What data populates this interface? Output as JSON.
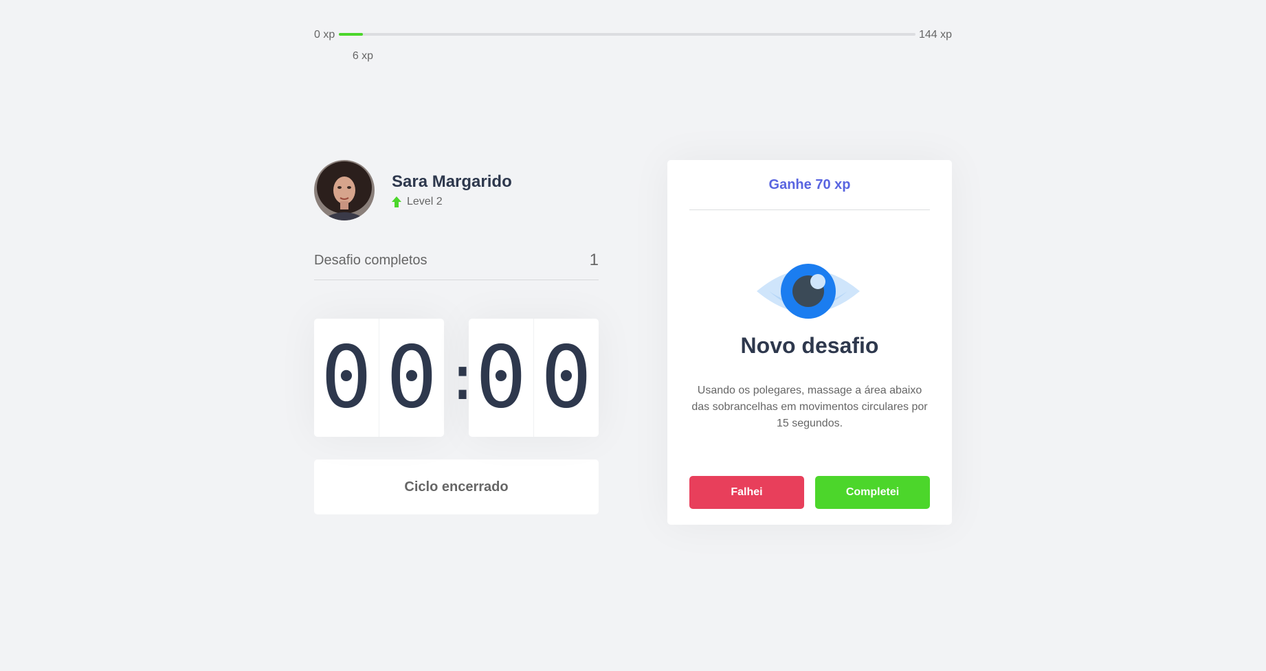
{
  "xp": {
    "min_label": "0 xp",
    "max_label": "144 xp",
    "current_label": "6 xp",
    "current": 6,
    "max": 144,
    "color": "#4cd62b"
  },
  "profile": {
    "name": "Sara Margarido",
    "level_label": "Level 2",
    "level_icon": "level-up-arrow-icon"
  },
  "challenges": {
    "label": "Desafio completos",
    "value": "1"
  },
  "countdown": {
    "minute_left": "0",
    "minute_right": "0",
    "separator": ":",
    "second_left": "0",
    "second_right": "0"
  },
  "cycle_button": {
    "label": "Ciclo encerrado"
  },
  "challenge_card": {
    "header": "Ganhe 70 xp",
    "icon": "eye-icon",
    "title": "Novo desafio",
    "description": "Usando os polegares, massage a área abaixo das sobrancelhas em movimentos circulares por 15 segundos.",
    "fail_label": "Falhei",
    "success_label": "Completei",
    "fail_color": "#e83f5b",
    "success_color": "#4cd62b",
    "accent_color": "#5965e0"
  }
}
